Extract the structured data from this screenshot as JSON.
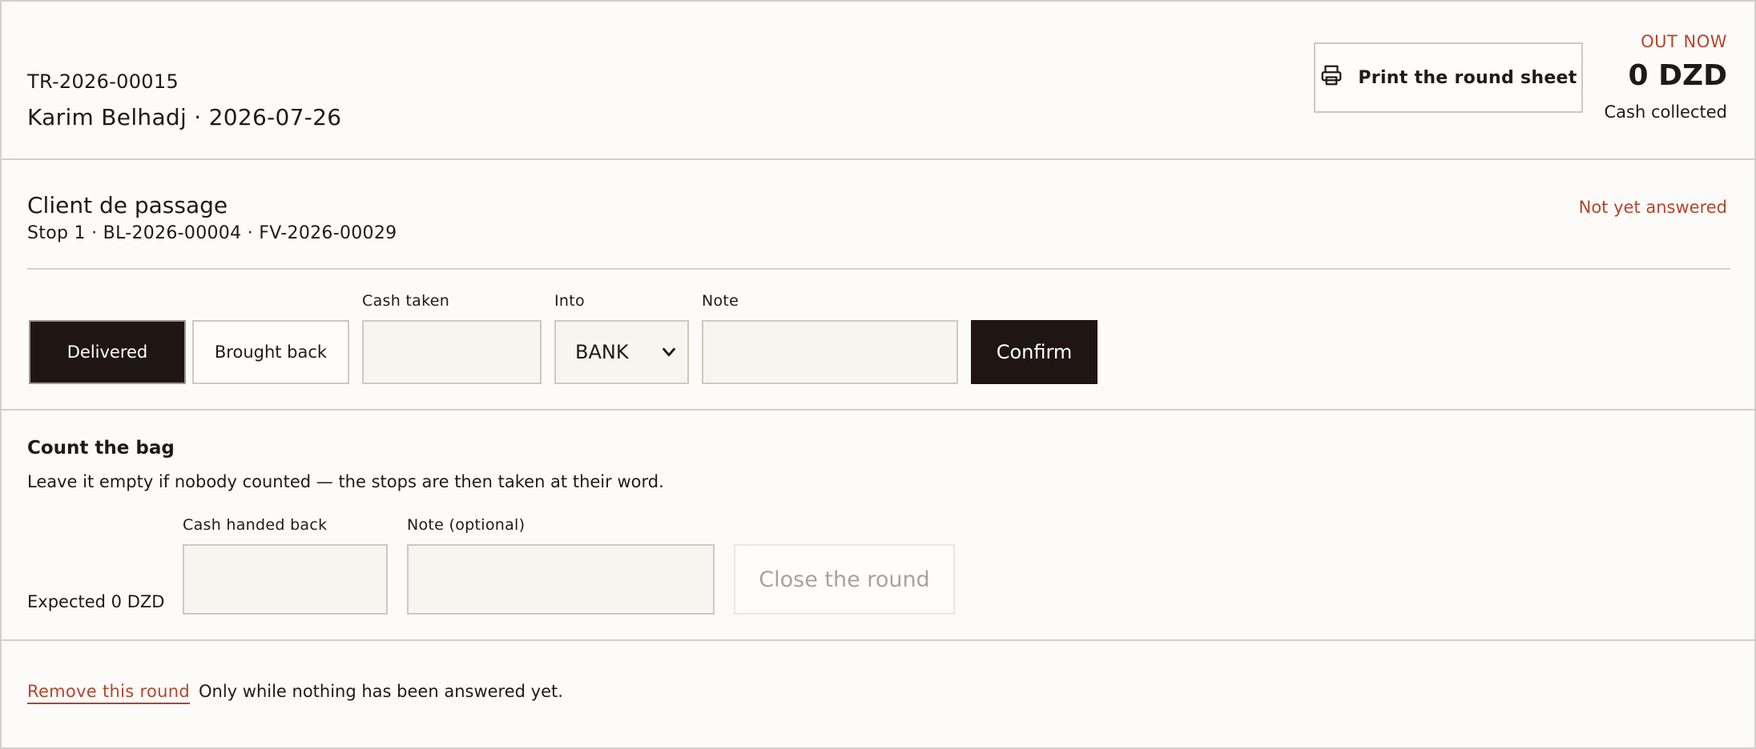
{
  "header": {
    "round_id": "TR-2026-00015",
    "driver_date": "Karim Belhadj · 2026-07-26",
    "print_label": "Print the round sheet",
    "status": "OUT NOW",
    "cash_amount": "0 DZD",
    "cash_label": "Cash collected"
  },
  "stop": {
    "client": "Client de passage",
    "refs": "Stop 1 · BL-2026-00004 · FV-2026-00029",
    "status": "Not yet answered",
    "delivered_label": "Delivered",
    "brought_back_label": "Brought back",
    "cash_taken_label": "Cash taken",
    "cash_taken_value": "",
    "into_label": "Into",
    "into_value": "BANK",
    "note_label": "Note",
    "note_value": "",
    "confirm_label": "Confirm"
  },
  "bag": {
    "title": "Count the bag",
    "description": "Leave it empty if nobody counted — the stops are then taken at their word.",
    "expected": "Expected 0 DZD",
    "cash_handed_back_label": "Cash handed back",
    "cash_handed_back_value": "",
    "note_label": "Note (optional)",
    "note_value": "",
    "close_label": "Close the round"
  },
  "remove": {
    "link_label": "Remove this round",
    "note": "Only while nothing has been answered yet."
  },
  "colors": {
    "accent": "#b5452b",
    "dark_button": "#1f1614",
    "input_bg": "#f8f5f0",
    "page_bg": "#fdfbf9"
  },
  "icons": {
    "print": "printer-icon",
    "select": "chevron-down-icon"
  }
}
